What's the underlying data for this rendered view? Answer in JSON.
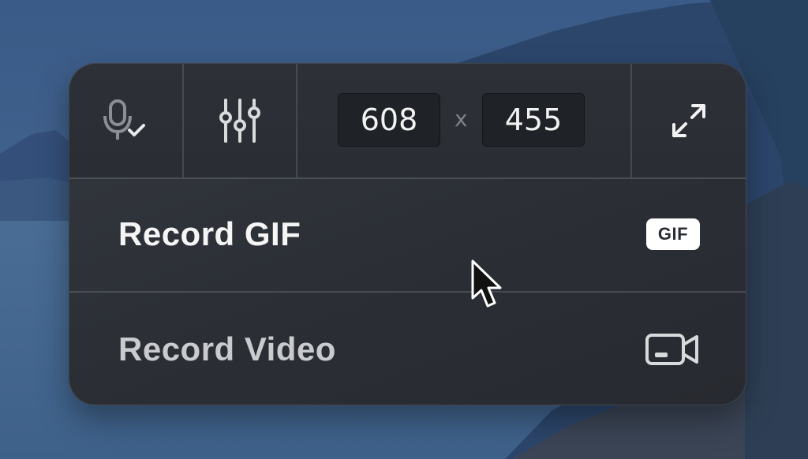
{
  "toolbar": {
    "microphone_icon": "microphone-check-icon",
    "settings_icon": "sliders-icon",
    "width_value": "608",
    "times_symbol": "x",
    "height_value": "455",
    "fullscreen_icon": "expand-icon"
  },
  "menu": {
    "items": [
      {
        "label": "Record GIF",
        "badge": "GIF",
        "icon": "gif-badge-icon"
      },
      {
        "label": "Record Video",
        "icon": "video-camera-icon"
      }
    ]
  },
  "colors": {
    "panel_bg": "#2b2f35",
    "text_primary": "#f5f5f5",
    "text_secondary": "#c9cbcf",
    "icon_color": "#d9dadc"
  }
}
